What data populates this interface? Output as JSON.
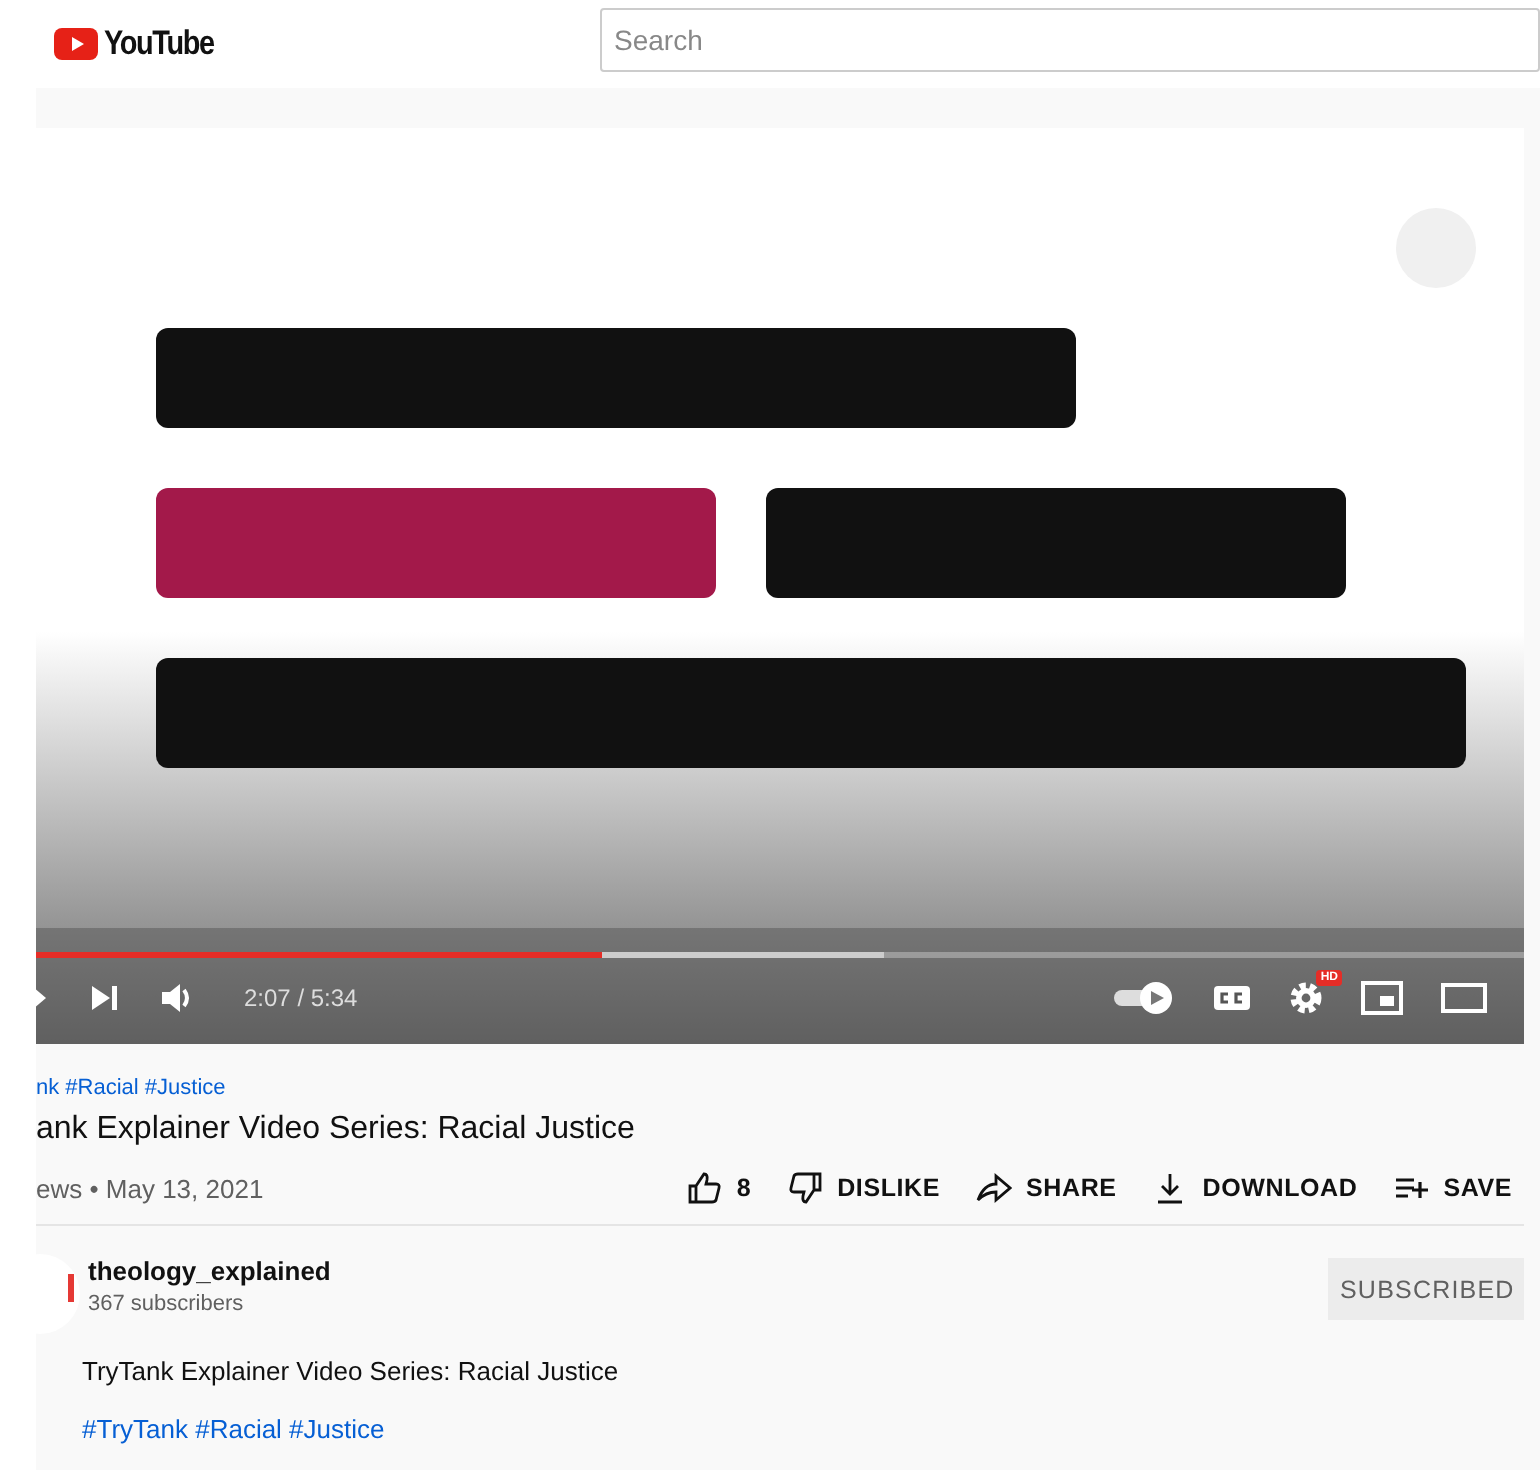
{
  "header": {
    "logo_text": "YouTube",
    "search": {
      "placeholder": "Search"
    }
  },
  "player": {
    "progress": {
      "level": 0.38
    },
    "buffered": {
      "level": 0.57
    },
    "time": "2:07 / 5:34",
    "autoplay": {
      "on": true
    },
    "quality_badge": "HD"
  },
  "video": {
    "hashtags": "nk #Racial #Justice",
    "title": "ank Explainer Video Series: Racial Justice",
    "meta": "ews • May 13, 2021",
    "actions": [
      {
        "kind": "like",
        "label": "8"
      },
      {
        "kind": "dislike",
        "label": "DISLIKE"
      },
      {
        "kind": "share",
        "label": "SHARE"
      },
      {
        "kind": "download",
        "label": "DOWNLOAD"
      },
      {
        "kind": "save",
        "label": "SAVE"
      }
    ]
  },
  "channel": {
    "name": "theology_explained",
    "subscribers": "367 subscribers",
    "subscribe_button": "SUBSCRIBED",
    "subscribed": true
  },
  "description": {
    "text": "TryTank Explainer Video Series: Racial Justice",
    "hashtags": "#TryTank #Racial #Justice"
  }
}
